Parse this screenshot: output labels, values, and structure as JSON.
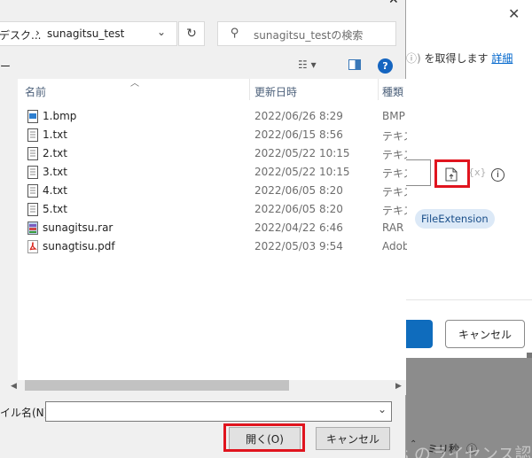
{
  "file_dialog": {
    "address": {
      "path_prefix": "デスク...",
      "separator": "›",
      "current_folder": "sunagitsu_test"
    },
    "search": {
      "placeholder": "sunagitsu_testの検索"
    },
    "toolbar": {
      "organize_label": "ー"
    },
    "columns": {
      "name": "名前",
      "date": "更新日時",
      "type": "種類"
    },
    "files": [
      {
        "name": "1.bmp",
        "date": "2022/06/26 8:29",
        "type": "BMP",
        "icon": "bmp-file-icon"
      },
      {
        "name": "1.txt",
        "date": "2022/06/15 8:56",
        "type": "テキス",
        "icon": "text-file-icon"
      },
      {
        "name": "2.txt",
        "date": "2022/05/22 10:15",
        "type": "テキス",
        "icon": "text-file-icon"
      },
      {
        "name": "3.txt",
        "date": "2022/05/22 10:15",
        "type": "テキス",
        "icon": "text-file-icon"
      },
      {
        "name": "4.txt",
        "date": "2022/06/05 8:20",
        "type": "テキス",
        "icon": "text-file-icon"
      },
      {
        "name": "5.txt",
        "date": "2022/06/05 8:20",
        "type": "テキス",
        "icon": "text-file-icon"
      },
      {
        "name": "sunagitsu.rar",
        "date": "2022/04/22 6:46",
        "type": "RAR T",
        "icon": "archive-file-icon"
      },
      {
        "name": "sunagtisu.pdf",
        "date": "2022/05/03 9:54",
        "type": "Adob",
        "icon": "pdf-file-icon"
      }
    ],
    "filename_label": "イル名(N):",
    "filename_value": "",
    "open_button": "開く(O)",
    "cancel_button": "キャンセル"
  },
  "background_dialog": {
    "info_text": "を取得します",
    "info_link": "詳細",
    "variable_chip": "FileExtension",
    "primary_button": "",
    "cancel_button": "キャンセル",
    "seconds_label": "ミリ秒",
    "watermark": "Windows のライセンス認証"
  },
  "colors": {
    "highlight": "#e0141e",
    "link": "#0066cc",
    "chip_bg": "#dce9f7",
    "primary": "#0f6cbd"
  }
}
